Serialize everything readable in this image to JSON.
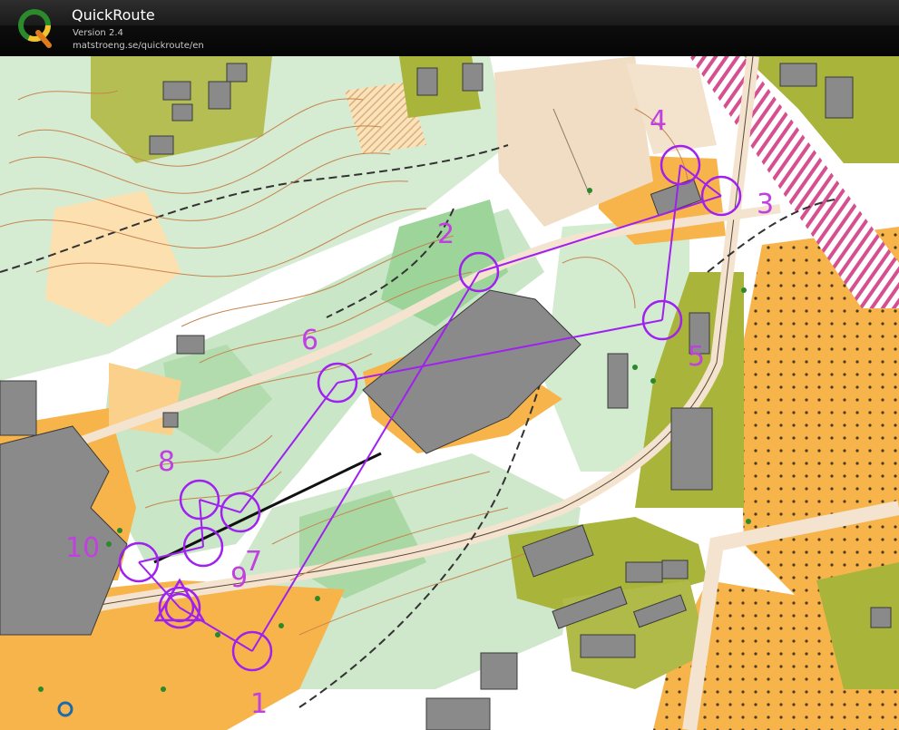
{
  "app": {
    "title": "QuickRoute",
    "version": "Version 2.4",
    "url": "matstroeng.se/quickroute/en"
  },
  "colors": {
    "course": "#a020f0",
    "route": "#9a30e0",
    "label": "#c040e0",
    "open_land": "#f7b44a",
    "rough_open": "#fde0b0",
    "forest_green": "#c9e6c6",
    "dark_green": "#9dd49a",
    "olive_private": "#a8b43a",
    "building": "#8a8a8a",
    "paved": "#f1ddc4",
    "railway": "#e06aa0"
  },
  "course": {
    "controls": [
      {
        "label": "1"
      },
      {
        "label": "2"
      },
      {
        "label": "3"
      },
      {
        "label": "4"
      },
      {
        "label": "5"
      },
      {
        "label": "6"
      },
      {
        "label": "7"
      },
      {
        "label": "8"
      },
      {
        "label": "9"
      },
      {
        "label": "10"
      }
    ],
    "start_icon": "start-triangle",
    "finish_icon": "finish-double-circle"
  }
}
